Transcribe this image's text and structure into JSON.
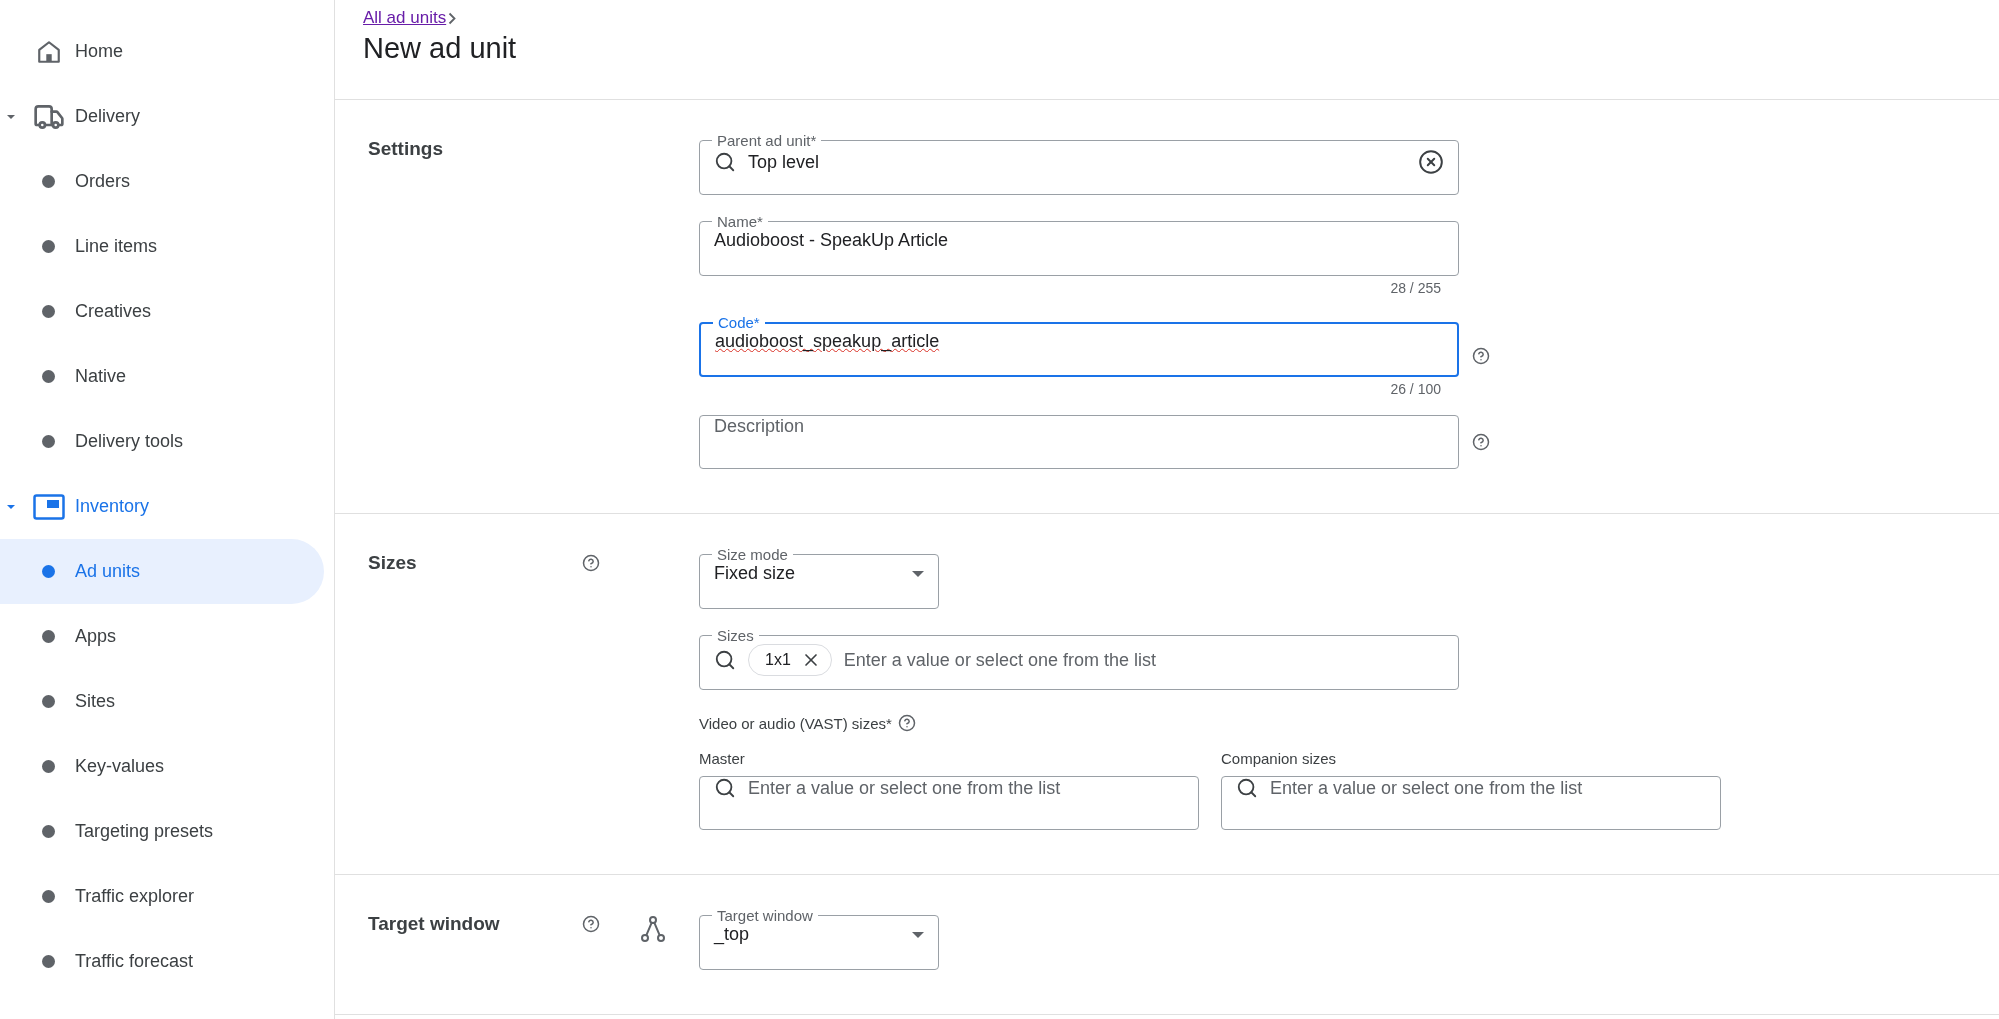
{
  "sidebar": {
    "items": [
      {
        "label": "Home"
      },
      {
        "label": "Delivery",
        "expanded": true,
        "children": [
          {
            "label": "Orders",
            "selected": false
          },
          {
            "label": "Line items",
            "selected": false
          },
          {
            "label": "Creatives",
            "selected": false
          },
          {
            "label": "Native",
            "selected": false
          },
          {
            "label": "Delivery tools",
            "selected": false
          }
        ]
      },
      {
        "label": "Inventory",
        "expanded": true,
        "children": [
          {
            "label": "Ad units",
            "selected": true
          },
          {
            "label": "Apps",
            "selected": false
          },
          {
            "label": "Sites",
            "selected": false
          },
          {
            "label": "Key-values",
            "selected": false
          },
          {
            "label": "Targeting presets",
            "selected": false
          },
          {
            "label": "Traffic explorer",
            "selected": false
          },
          {
            "label": "Traffic forecast",
            "selected": false
          }
        ]
      }
    ]
  },
  "header": {
    "breadcrumb": "All ad units",
    "title": "New ad unit"
  },
  "sections": [
    {
      "title": "Settings",
      "fields": [
        {
          "kind": "search",
          "label": "Parent ad unit*",
          "value": "Top level",
          "clearable": true
        },
        {
          "kind": "text",
          "label": "Name*",
          "value": "Audioboost - SpeakUp Article",
          "counter": "28 / 255"
        },
        {
          "kind": "text",
          "label": "Code*",
          "value": "audioboost_speakup_article",
          "counter": "26 / 100",
          "focused": true,
          "spelling_error": true,
          "help": true
        },
        {
          "kind": "text",
          "placeholder": "Description",
          "help": true
        }
      ]
    },
    {
      "title": "Sizes",
      "help": true,
      "fields": [
        {
          "kind": "select",
          "label": "Size mode",
          "value": "Fixed size"
        },
        {
          "kind": "chips",
          "label": "Sizes",
          "chips": [
            "1x1"
          ],
          "placeholder": "Enter a value or select one from the list"
        },
        {
          "kind": "group",
          "label": "Video or audio (VAST) sizes*",
          "help": true,
          "columns": [
            {
              "label": "Master",
              "placeholder": "Enter a value or select one from the list"
            },
            {
              "label": "Companion sizes",
              "placeholder": "Enter a value or select one from the list"
            }
          ]
        }
      ]
    },
    {
      "title": "Target window",
      "help": true,
      "fields": [
        {
          "kind": "select",
          "label": "Target window",
          "value": "_top"
        }
      ]
    }
  ]
}
